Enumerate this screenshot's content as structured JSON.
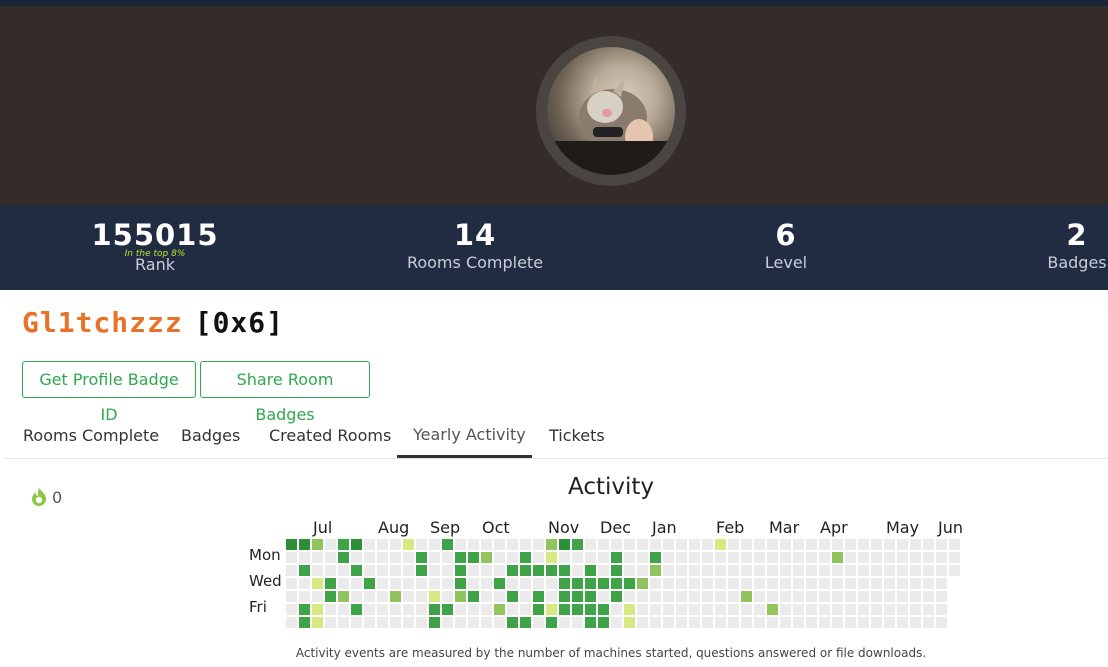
{
  "stats": [
    {
      "value": "155015",
      "label": "Rank",
      "sub": "In the top 8%"
    },
    {
      "value": "14",
      "label": "Rooms Complete"
    },
    {
      "value": "6",
      "label": "Level"
    },
    {
      "value": "2",
      "label": "Badges"
    }
  ],
  "profile": {
    "username": "Gl1tchzzz",
    "level_tag": "[0x6]"
  },
  "buttons": {
    "badge_id": "Get Profile Badge ID",
    "share": "Share Room Badges"
  },
  "tabs": [
    {
      "label": "Rooms Complete",
      "active": false
    },
    {
      "label": "Badges",
      "active": false
    },
    {
      "label": "Created Rooms",
      "active": false
    },
    {
      "label": "Yearly Activity",
      "active": true
    },
    {
      "label": "Tickets",
      "active": false
    }
  ],
  "streak": {
    "count": "0",
    "icon": "flame-icon"
  },
  "activity": {
    "title": "Activity",
    "months": [
      "Jul",
      "Aug",
      "Sep",
      "Oct",
      "Nov",
      "Dec",
      "Jan",
      "Feb",
      "Mar",
      "Apr",
      "May",
      "Jun"
    ],
    "days": [
      "Mon",
      "Wed",
      "Fri"
    ],
    "footnote": "Activity events are measured by the number of machines started, questions answered or file downloads.",
    "weeks": 52,
    "colors": {
      "0": "#ebebeb",
      "1": "#d8e882",
      "2": "#92c45e",
      "3": "#3fa447",
      "4": "#2d8f3a"
    },
    "active_days": [
      [
        0,
        0,
        4
      ],
      [
        1,
        0,
        4
      ],
      [
        1,
        2,
        3
      ],
      [
        1,
        5,
        3
      ],
      [
        1,
        6,
        3
      ],
      [
        2,
        0,
        2
      ],
      [
        2,
        3,
        1
      ],
      [
        2,
        5,
        1
      ],
      [
        2,
        6,
        1
      ],
      [
        3,
        3,
        3
      ],
      [
        3,
        4,
        3
      ],
      [
        4,
        0,
        3
      ],
      [
        4,
        1,
        3
      ],
      [
        4,
        4,
        2
      ],
      [
        5,
        0,
        4
      ],
      [
        5,
        2,
        3
      ],
      [
        5,
        5,
        3
      ],
      [
        6,
        3,
        3
      ],
      [
        8,
        4,
        2
      ],
      [
        9,
        0,
        1
      ],
      [
        10,
        1,
        3
      ],
      [
        10,
        2,
        3
      ],
      [
        11,
        4,
        1
      ],
      [
        11,
        5,
        3
      ],
      [
        11,
        6,
        3
      ],
      [
        12,
        0,
        3
      ],
      [
        12,
        5,
        3
      ],
      [
        13,
        1,
        3
      ],
      [
        13,
        2,
        3
      ],
      [
        13,
        3,
        3
      ],
      [
        13,
        4,
        2
      ],
      [
        14,
        1,
        3
      ],
      [
        14,
        4,
        3
      ],
      [
        15,
        1,
        2
      ],
      [
        16,
        3,
        3
      ],
      [
        16,
        5,
        2
      ],
      [
        17,
        2,
        3
      ],
      [
        17,
        4,
        3
      ],
      [
        17,
        6,
        3
      ],
      [
        18,
        1,
        3
      ],
      [
        18,
        2,
        3
      ],
      [
        18,
        6,
        3
      ],
      [
        19,
        2,
        3
      ],
      [
        19,
        4,
        3
      ],
      [
        19,
        5,
        3
      ],
      [
        20,
        0,
        2
      ],
      [
        20,
        1,
        1
      ],
      [
        20,
        2,
        3
      ],
      [
        20,
        5,
        1
      ],
      [
        20,
        6,
        3
      ],
      [
        21,
        0,
        4
      ],
      [
        21,
        2,
        3
      ],
      [
        21,
        3,
        3
      ],
      [
        21,
        4,
        3
      ],
      [
        21,
        5,
        3
      ],
      [
        22,
        0,
        3
      ],
      [
        22,
        3,
        3
      ],
      [
        22,
        4,
        3
      ],
      [
        22,
        5,
        3
      ],
      [
        23,
        2,
        3
      ],
      [
        23,
        3,
        3
      ],
      [
        23,
        4,
        3
      ],
      [
        23,
        5,
        3
      ],
      [
        23,
        6,
        3
      ],
      [
        24,
        3,
        3
      ],
      [
        24,
        5,
        3
      ],
      [
        24,
        6,
        3
      ],
      [
        25,
        1,
        3
      ],
      [
        25,
        2,
        3
      ],
      [
        25,
        3,
        3
      ],
      [
        25,
        4,
        3
      ],
      [
        26,
        3,
        3
      ],
      [
        26,
        5,
        1
      ],
      [
        26,
        6,
        1
      ],
      [
        27,
        3,
        2
      ],
      [
        28,
        1,
        3
      ],
      [
        28,
        2,
        2
      ],
      [
        33,
        0,
        1
      ],
      [
        35,
        4,
        2
      ],
      [
        37,
        5,
        2
      ],
      [
        42,
        1,
        2
      ]
    ]
  }
}
